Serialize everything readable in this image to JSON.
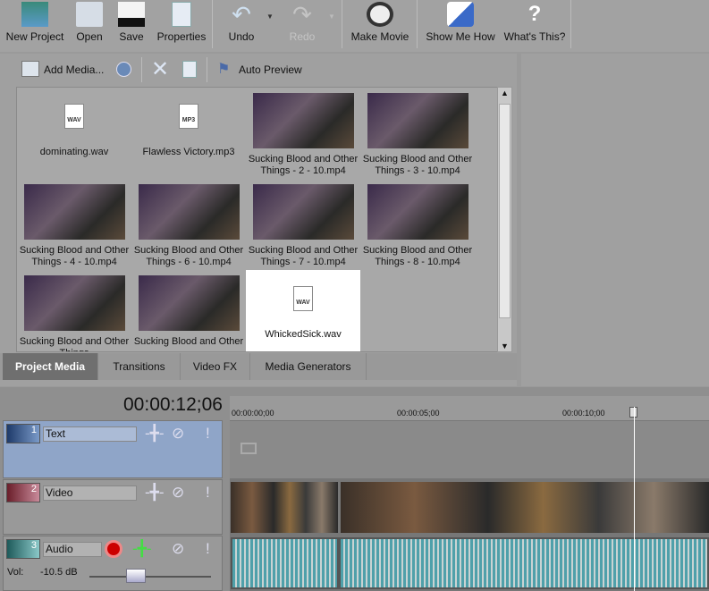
{
  "toolbar": {
    "new_project": "New Project",
    "open": "Open",
    "save": "Save",
    "properties": "Properties",
    "undo": "Undo",
    "redo": "Redo",
    "make_movie": "Make Movie",
    "show_me_how": "Show Me How",
    "whats_this": "What's This?"
  },
  "media_toolbar": {
    "add_media": "Add Media...",
    "auto_preview": "Auto Preview"
  },
  "media_items": [
    {
      "name": "dominating.wav",
      "type": "WAV"
    },
    {
      "name": "Flawless Victory.mp3",
      "type": "MP3"
    },
    {
      "name": "Sucking Blood and Other Things - 2 - 10.mp4",
      "type": "video"
    },
    {
      "name": "Sucking Blood and Other Things - 3 - 10.mp4",
      "type": "video"
    },
    {
      "name": "Sucking Blood and Other Things - 4 - 10.mp4",
      "type": "video"
    },
    {
      "name": "Sucking Blood and Other Things - 6 - 10.mp4",
      "type": "video"
    },
    {
      "name": "Sucking Blood and Other Things - 7 - 10.mp4",
      "type": "video"
    },
    {
      "name": "Sucking Blood and Other Things - 8 - 10.mp4",
      "type": "video"
    },
    {
      "name": "Sucking Blood and Other Things",
      "type": "video"
    },
    {
      "name": "Sucking Blood and Other",
      "type": "video"
    },
    {
      "name": "WhickedSick.wav",
      "type": "WAV",
      "selected": true
    }
  ],
  "tabs": [
    "Project Media",
    "Transitions",
    "Video FX",
    "Media Generators"
  ],
  "timeline": {
    "time": "00:00:12;06",
    "ruler": [
      "00:00:00;00",
      "00:00:05;00",
      "00:00:10;00"
    ],
    "tracks": [
      {
        "num": "1",
        "name": "Text"
      },
      {
        "num": "2",
        "name": "Video"
      },
      {
        "num": "3",
        "name": "Audio"
      }
    ],
    "vol_label": "Vol:",
    "vol_value": "-10.5 dB",
    "vol_fraction": 0.3
  }
}
